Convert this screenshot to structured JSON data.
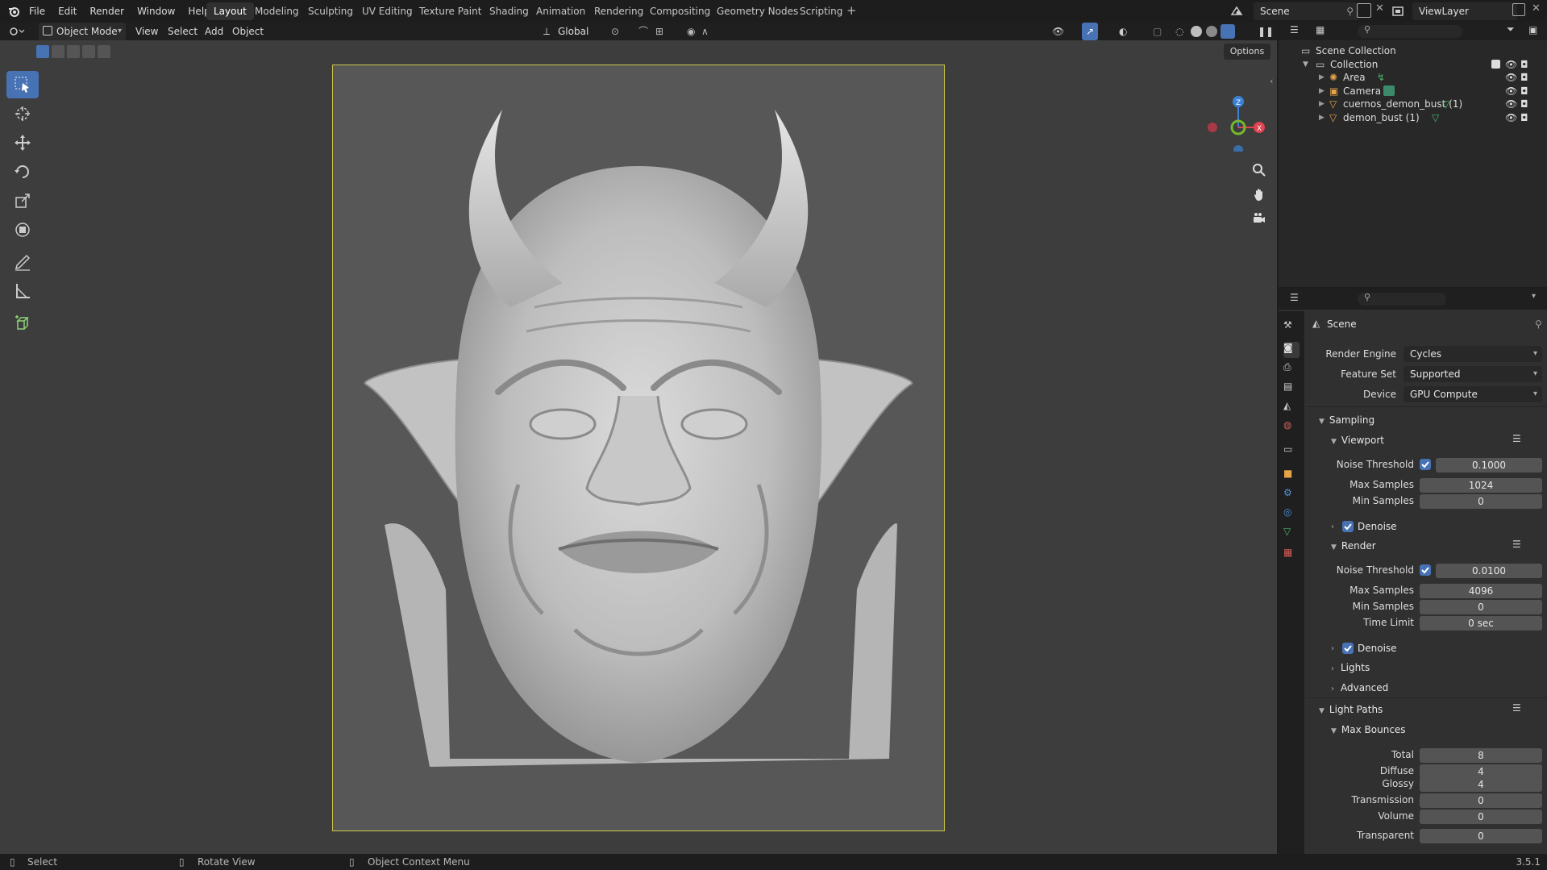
{
  "top_menu": [
    "File",
    "Edit",
    "Render",
    "Window",
    "Help"
  ],
  "workspaces": [
    "Layout",
    "Modeling",
    "Sculpting",
    "UV Editing",
    "Texture Paint",
    "Shading",
    "Animation",
    "Rendering",
    "Compositing",
    "Geometry Nodes",
    "Scripting"
  ],
  "active_workspace": "Layout",
  "scene_name": "Scene",
  "view_layer": "ViewLayer",
  "viewport_header": {
    "mode": "Object Mode",
    "menus": [
      "View",
      "Select",
      "Add",
      "Object"
    ],
    "transform_orientation": "Global",
    "options_label": "Options"
  },
  "toolbar_tools": [
    "select-box",
    "cursor",
    "move",
    "rotate",
    "scale",
    "transform",
    "annotate",
    "measure",
    "add-cube"
  ],
  "outliner": {
    "root": "Scene Collection",
    "collection": "Collection",
    "items": [
      {
        "name": "Area",
        "type": "light"
      },
      {
        "name": "Camera",
        "type": "camera"
      },
      {
        "name": "cuernos_demon_bust (1)",
        "type": "mesh"
      },
      {
        "name": "demon_bust (1)",
        "type": "mesh"
      }
    ]
  },
  "properties": {
    "context": "Scene",
    "render_engine_label": "Render Engine",
    "render_engine": "Cycles",
    "feature_set_label": "Feature Set",
    "feature_set": "Supported",
    "device_label": "Device",
    "device": "GPU Compute",
    "sampling": "Sampling",
    "viewport": "Viewport",
    "noise_threshold_label": "Noise Threshold",
    "max_samples_label": "Max Samples",
    "min_samples_label": "Min Samples",
    "viewport_noise_threshold": "0.1000",
    "viewport_max_samples": "1024",
    "viewport_min_samples": "0",
    "denoise_label": "Denoise",
    "render": "Render",
    "render_noise_threshold": "0.0100",
    "render_max_samples": "4096",
    "render_min_samples": "0",
    "time_limit_label": "Time Limit",
    "render_time_limit": "0 sec",
    "lights": "Lights",
    "advanced": "Advanced",
    "light_paths": "Light Paths",
    "max_bounces": "Max Bounces",
    "bounces": [
      {
        "label": "Total",
        "value": "8"
      },
      {
        "label": "Diffuse",
        "value": "4"
      },
      {
        "label": "Glossy",
        "value": "4"
      },
      {
        "label": "Transmission",
        "value": "0"
      },
      {
        "label": "Volume",
        "value": "0"
      },
      {
        "label": "Transparent",
        "value": "0"
      }
    ]
  },
  "statusbar": {
    "left": "Select",
    "middle": "Rotate View",
    "right_action": "Object Context Menu",
    "version": "3.5.1"
  },
  "colors": {
    "accent": "#4772b3",
    "camera_frame": "#c8c44a",
    "axis_x": "#e04452",
    "axis_y": "#76b82a",
    "axis_z": "#3b82d6"
  }
}
